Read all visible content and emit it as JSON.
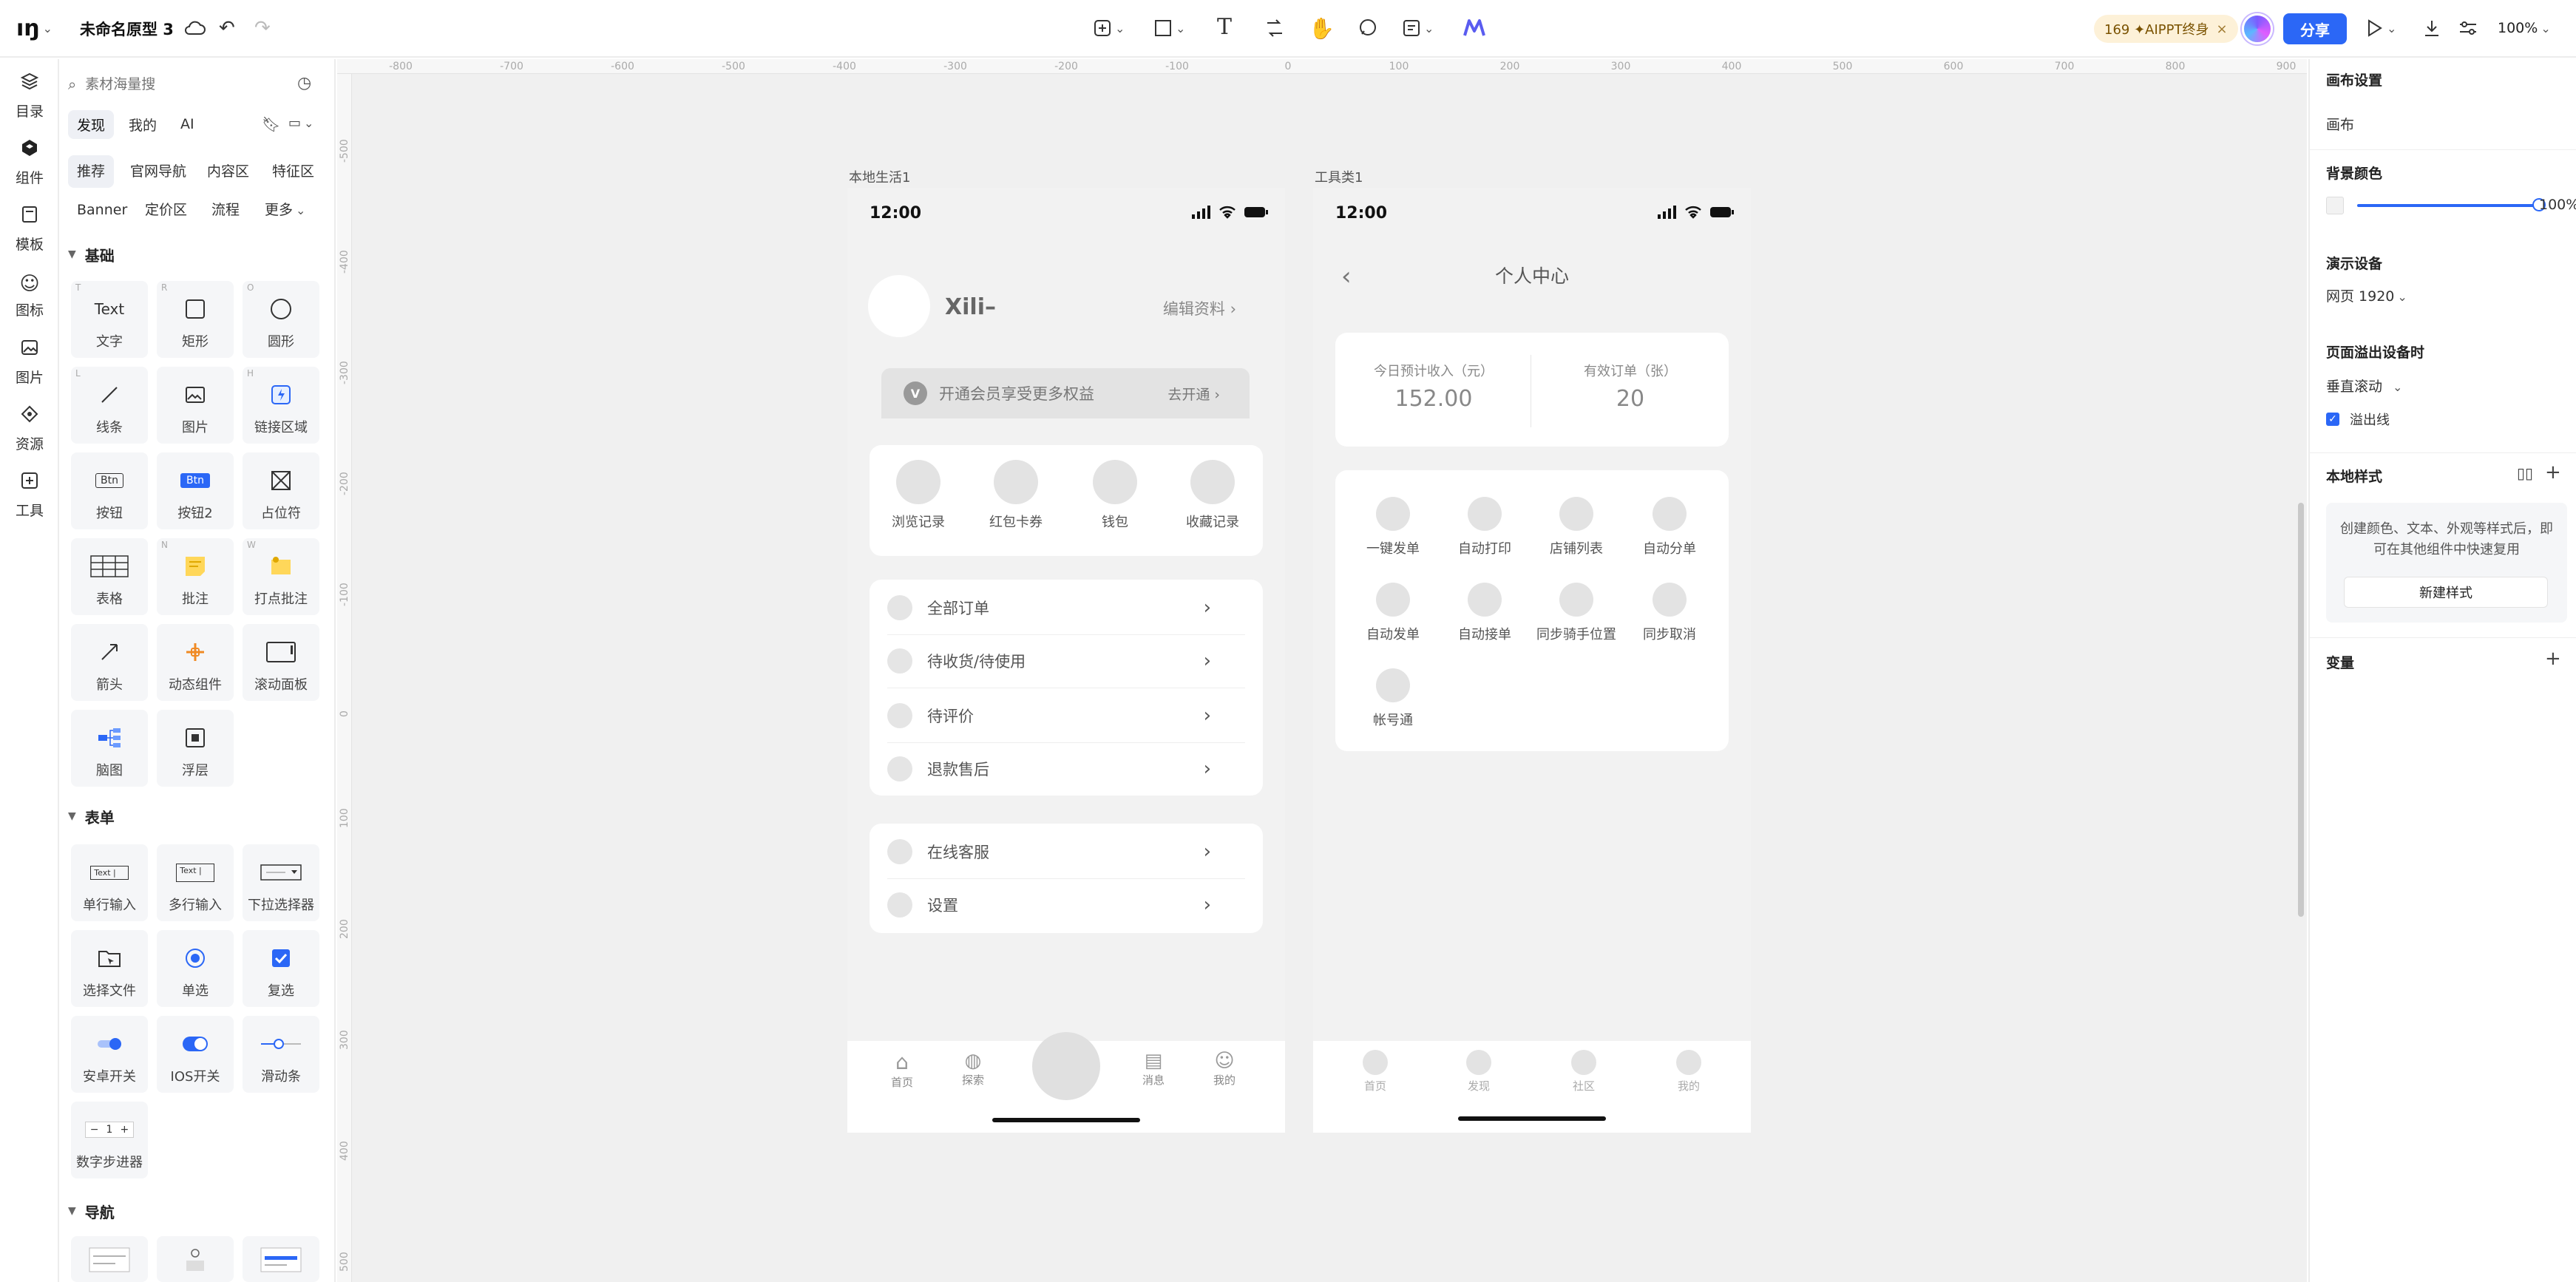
{
  "app": {
    "project_name": "未命名原型 3",
    "share_label": "分享",
    "promo_label": "169 ✦AIPPT终身",
    "zoom": "100%"
  },
  "left_nav": [
    {
      "label": "目录",
      "icon": "layers-icon"
    },
    {
      "label": "组件",
      "icon": "component-icon"
    },
    {
      "label": "模板",
      "icon": "template-icon"
    },
    {
      "label": "图标",
      "icon": "smile-icon"
    },
    {
      "label": "图片",
      "icon": "image-icon"
    },
    {
      "label": "资源",
      "icon": "resource-icon"
    },
    {
      "label": "工具",
      "icon": "tool-icon"
    }
  ],
  "panel": {
    "search_placeholder": "素材海量搜",
    "tabs": [
      "发现",
      "我的",
      "AI"
    ],
    "chips_row1": [
      "推荐",
      "官网导航",
      "内容区",
      "特征区"
    ],
    "chips_row2": [
      "Banner",
      "定价区",
      "流程",
      "更多"
    ],
    "section_basic": "基础",
    "section_form": "表单",
    "section_nav": "导航",
    "basic_items": [
      "文字",
      "矩形",
      "圆形",
      "线条",
      "图片",
      "链接区域",
      "按钮",
      "按钮2",
      "占位符",
      "表格",
      "批注",
      "打点批注",
      "箭头",
      "动态组件",
      "滚动面板",
      "脑图",
      "浮层"
    ],
    "basic_hotkeys": [
      "T",
      "R",
      "O",
      "L",
      "",
      "H",
      "",
      "",
      "",
      "",
      "N",
      "W",
      "",
      "",
      "",
      "",
      ""
    ],
    "text_sample": "Text",
    "btn_sample": "Btn",
    "form_items": [
      "单行输入",
      "多行输入",
      "下拉选择器",
      "选择文件",
      "单选",
      "复选",
      "安卓开关",
      "IOS开关",
      "滑动条",
      "数字步进器"
    ],
    "input_sample": "Text |",
    "stepper_minus": "−",
    "stepper_value": "1",
    "stepper_plus": "+"
  },
  "canvas": {
    "ruler_top": [
      "-800",
      "-700",
      "-600",
      "-500",
      "-400",
      "-300",
      "-200",
      "-100",
      "0",
      "100",
      "200",
      "300",
      "400",
      "500",
      "600",
      "700",
      "800",
      "900"
    ],
    "ruler_left": [
      "-500",
      "-400",
      "-300",
      "-200",
      "-100",
      "0",
      "100",
      "200",
      "300",
      "400",
      "500"
    ],
    "frame1": {
      "label": "本地生活1",
      "time": "12:00",
      "username": "Xili–",
      "edit_profile": "编辑资料 ›",
      "vip_text": "开通会员享受更多权益",
      "vip_action": "去开通 ›",
      "quick": [
        "浏览记录",
        "红包卡券",
        "钱包",
        "收藏记录"
      ],
      "orders": [
        "全部订单",
        "待收货/待使用",
        "待评价",
        "退款售后"
      ],
      "services": [
        "在线客服",
        "设置"
      ],
      "tabbar": [
        "首页",
        "探索",
        "消息",
        "我的"
      ]
    },
    "frame2": {
      "label": "工具类1",
      "time": "12:00",
      "title": "个人中心",
      "stat1_label": "今日预计收入（元）",
      "stat1_value": "152.00",
      "stat2_label": "有效订单（张）",
      "stat2_value": "20",
      "grid": [
        "一键发单",
        "自动打印",
        "店铺列表",
        "自动分单",
        "自动发单",
        "自动接单",
        "同步骑手位置",
        "同步取消",
        "帐号通"
      ],
      "tabbar": [
        "首页",
        "发现",
        "社区",
        "我的"
      ]
    }
  },
  "right": {
    "canvas_settings": "画布设置",
    "canvas": "画布",
    "bg_color": "背景颜色",
    "bg_opacity": "100%",
    "bg_opacity_value": 1.0,
    "device_label": "演示设备",
    "device_value": "网页 1920",
    "overflow_label": "页面溢出设备时",
    "overflow_value": "垂直滚动",
    "overflow_line": "溢出线",
    "overflow_line_checked": true,
    "local_styles": "本地样式",
    "local_styles_hint": "创建颜色、文本、外观等样式后，即可在其他组件中快速复用",
    "new_style": "新建样式",
    "variables": "变量"
  },
  "colors": {
    "accent": "#2b67f6",
    "promo_bg": "#fdf1d8",
    "canvas_bg": "#f0f0f0"
  }
}
